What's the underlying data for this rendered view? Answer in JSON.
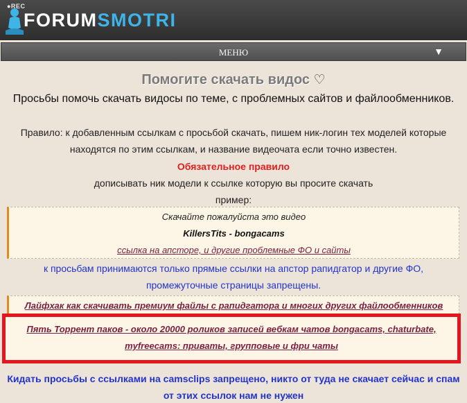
{
  "header": {
    "logo_rec": "●REC",
    "logo_part1": "FORUM",
    "logo_part2": "SMOTRI",
    "brand_color": "#3fb4e6"
  },
  "menu": {
    "label": "МЕНЮ",
    "arrow": "▼"
  },
  "page": {
    "title": "Помогите скачать видос",
    "title_icon": "heart-icon",
    "description": "Просьбы помочь скачать видосы по теме, с проблемных сайтов и файлообменников.",
    "rule_line1": "Правило: к добавленным ссылкам с просьбой скачать, пишем ник-логин тех моделей которые",
    "rule_line2": "находятся по этим ссылкам, и название видеочата если точно известен.",
    "mandatory_rule": "Обязательное правило",
    "rule_line3": "дописывать ник модели к ссылке которую вы просите скачать",
    "example_label": "пример:"
  },
  "example_quote": {
    "ask": "Скачайте пожалуйста это видео",
    "model": "KillersTits - bongacams",
    "link": "ссылка на апсторе, и другие проблемные ФО и сайты"
  },
  "notice": {
    "line1": "к просьбам принимаются только прямые ссылки на апстор рапидгатор и другие ФО,",
    "line2": "промежуточные страницы запрещены."
  },
  "links": {
    "lifehack": "Лайфхак как скачивать премиум файлы с рапидгатора и многих других файлообменников",
    "torrent_line1": "Пять Торрент паков - около 20000 роликов записей вебкам чатов bongacams, chaturbate,",
    "torrent_line2": "myfreecams: приваты, групповые и фри чаты"
  },
  "warning": {
    "line1": "Кидать просьбы с ссылками на camsclips запрещено, никто от туда не скачает сейчас и спам",
    "line2": "от этих ссылок нам не нужен"
  },
  "colors": {
    "background": "#ede4d9",
    "highlight_border": "#e4151e",
    "link_color": "#7a1f3f",
    "notice_color": "#2233cc",
    "mandatory_color": "#e02020"
  }
}
